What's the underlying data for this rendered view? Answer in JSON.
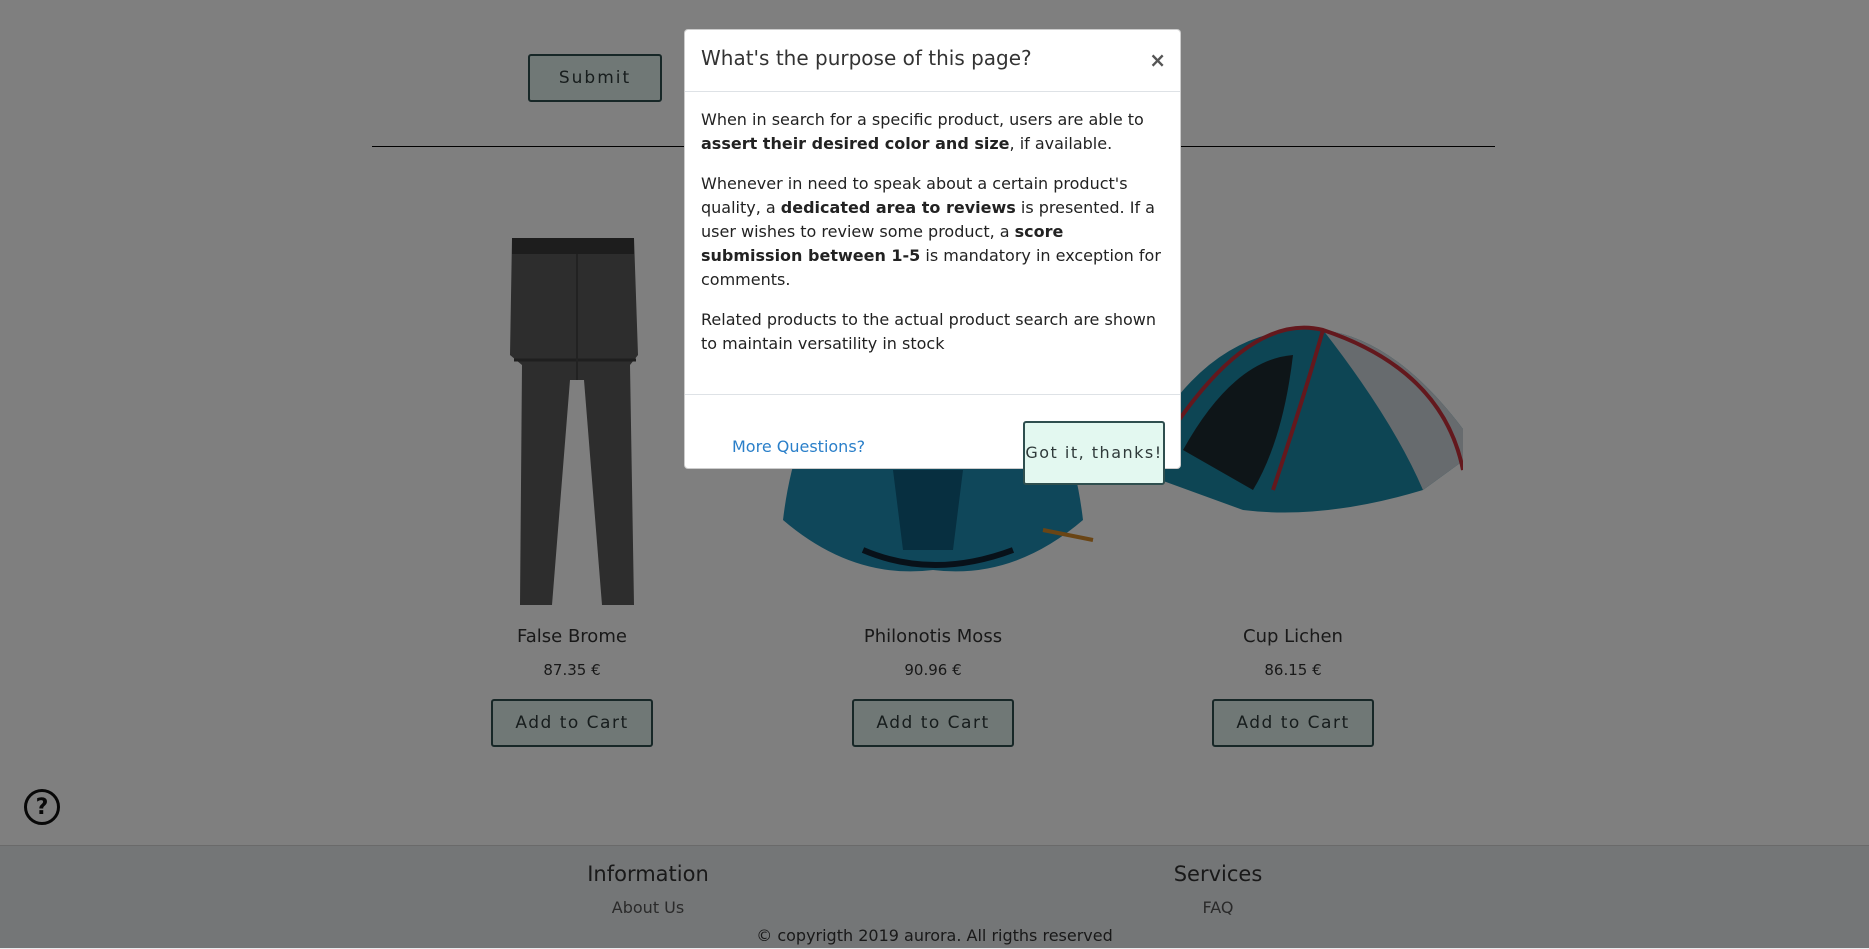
{
  "form": {
    "submit_label": "Submit"
  },
  "products": [
    {
      "name": "False Brome",
      "price": "87.35 €",
      "button": "Add to Cart",
      "image": "gray-pants"
    },
    {
      "name": "Philonotis Moss",
      "price": "90.96 €",
      "button": "Add to Cart",
      "image": "blue-popup-tent"
    },
    {
      "name": "Cup Lichen",
      "price": "86.15 €",
      "button": "Add to Cart",
      "image": "teal-dome-tent"
    }
  ],
  "help": {
    "icon": "question-circle-icon"
  },
  "footer": {
    "info_title": "Information",
    "info_link": "About Us",
    "services_title": "Services",
    "services_link": "FAQ",
    "copyright": "© copyrigth 2019 aurora. All rigths reserved"
  },
  "modal": {
    "title": "What's the purpose of this page?",
    "close": "×",
    "p1_a": "When in search for a specific product, users are able to ",
    "p1_b": "assert their desired color and size",
    "p1_c": ", if available.",
    "p2_a": "Whenever in need to speak about a certain product's quality, a ",
    "p2_b": "dedicated area to reviews",
    "p2_c": " is presented. If a user wishes to review some product, a ",
    "p2_d": "score submission between 1-5",
    "p2_e": " is mandatory in exception for comments.",
    "p3": "Related products to the actual product search are shown to maintain versatility in stock",
    "more_link": "More Questions?",
    "got_it": "Got it, thanks!"
  }
}
